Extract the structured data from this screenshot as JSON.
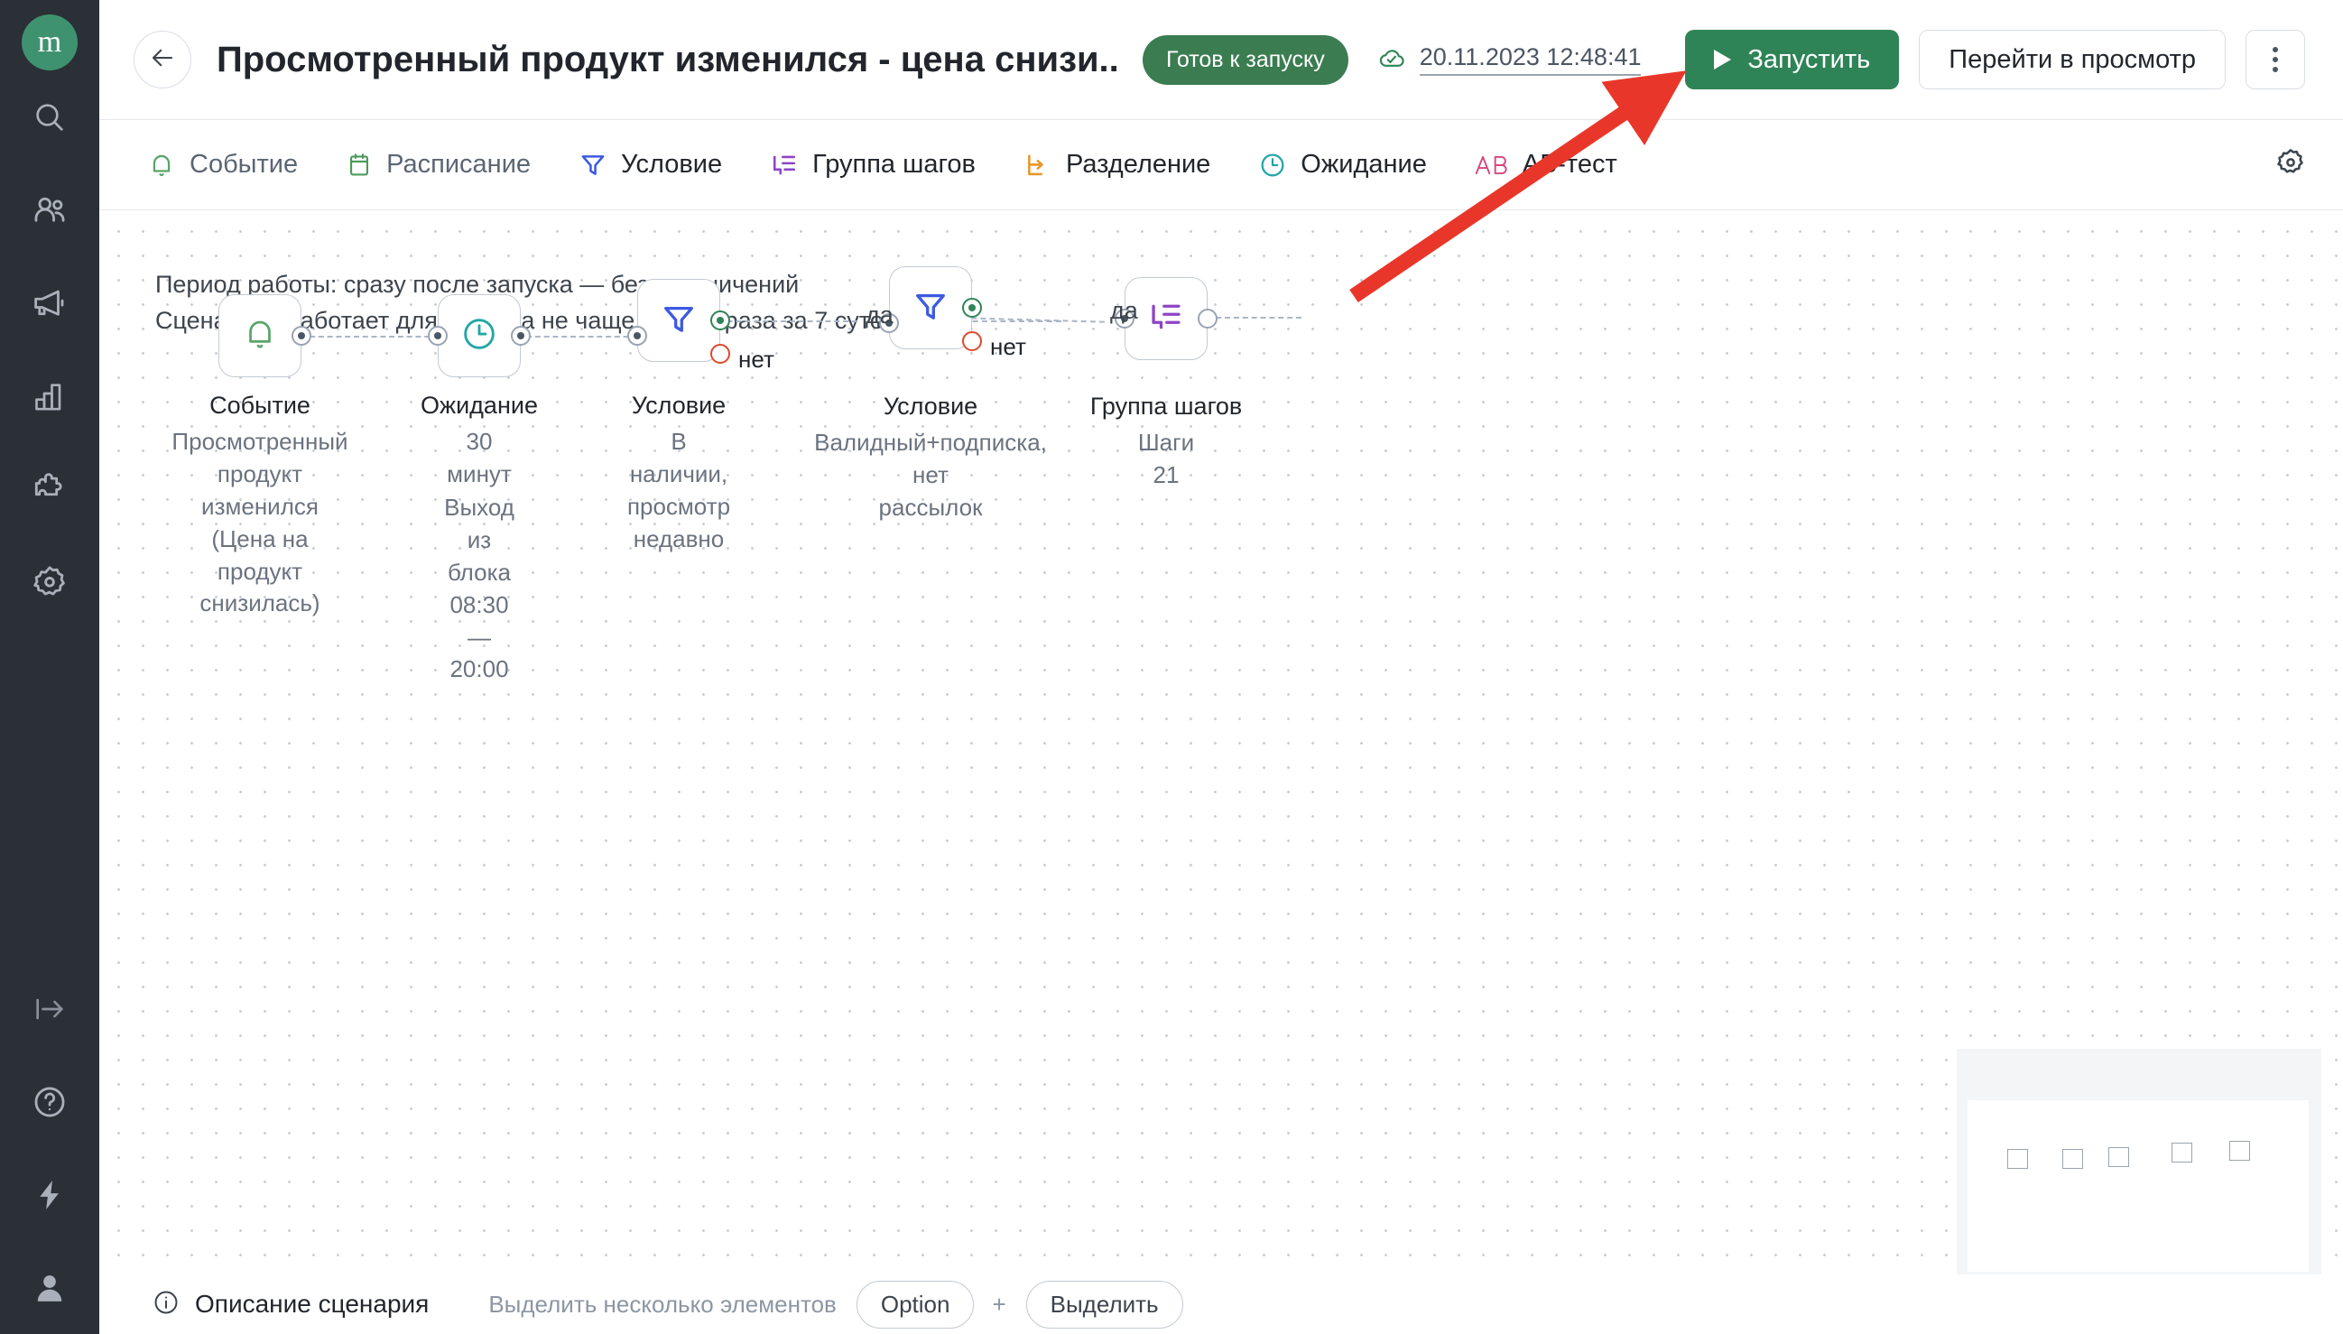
{
  "brand": {
    "logo_letter": "m",
    "accent": "#3f9270"
  },
  "sidebar": {
    "items": [
      {
        "name": "search-icon",
        "label": "Поиск"
      },
      {
        "name": "users-icon",
        "label": "Клиенты"
      },
      {
        "name": "megaphone-icon",
        "label": "Кампании"
      },
      {
        "name": "bar-chart-icon",
        "label": "Аналитика"
      },
      {
        "name": "puzzle-icon",
        "label": "Интеграции"
      },
      {
        "name": "gear-icon",
        "label": "Настройки"
      }
    ],
    "bottom_items": [
      {
        "name": "collapse-icon",
        "label": "Свернуть"
      },
      {
        "name": "help-icon",
        "label": "Помощь"
      },
      {
        "name": "lightning-icon",
        "label": "Активность"
      },
      {
        "name": "account-icon",
        "label": "Аккаунт"
      }
    ]
  },
  "header": {
    "back_label": "Назад",
    "title": "Просмотренный продукт изменился - цена снизи...",
    "status_badge": "Готов к запуску",
    "saved_timestamp": "20.11.2023 12:48:41",
    "saved_icon": "cloud-check-icon",
    "run_button": "Запустить",
    "preview_button": "Перейти в просмотр",
    "more_button": "Ещё",
    "run_button_color": "#2f8457",
    "status_badge_color": "#3b7d51"
  },
  "toolbar": {
    "items": [
      {
        "label": "Событие",
        "icon": "bell-icon",
        "color": "#5aa469",
        "emphasis": "muted"
      },
      {
        "label": "Расписание",
        "icon": "calendar-icon",
        "color": "#4c9a5a",
        "emphasis": "muted"
      },
      {
        "label": "Условие",
        "icon": "filter-icon",
        "color": "#3d5ae0",
        "emphasis": "dark"
      },
      {
        "label": "Группа шагов",
        "icon": "steps-icon",
        "color": "#8e44c4",
        "emphasis": "dark"
      },
      {
        "label": "Разделение",
        "icon": "split-icon",
        "color": "#e8972a",
        "emphasis": "dark"
      },
      {
        "label": "Ожидание",
        "icon": "clock-icon",
        "color": "#22a6a6",
        "emphasis": "dark"
      },
      {
        "label": "АБ-тест",
        "icon": "ab-icon",
        "color": "#d6467f",
        "emphasis": "dark"
      }
    ],
    "settings_label": "Настройки холста"
  },
  "canvas": {
    "period_line_1": "Период работы: сразу после запуска — без ограничений",
    "period_line_2": "Сценарий сработает для клиента не чаще одного раза за 7 суток",
    "nodes": [
      {
        "id": "event",
        "type_label": "Событие",
        "icon": "bell-icon",
        "icon_color": "#5aa469",
        "description": [
          "Просмотренный продукт",
          "изменился (Цена на продукт",
          "снизилась)"
        ]
      },
      {
        "id": "wait",
        "type_label": "Ожидание",
        "icon": "clock-icon",
        "icon_color": "#22a6a6",
        "description": [
          "30 минут"
        ],
        "extra": [
          "Выход из блока",
          "08:30 — 20:00"
        ]
      },
      {
        "id": "condition-1",
        "type_label": "Условие",
        "icon": "filter-icon",
        "icon_color": "#3d5ae0",
        "description": [
          "В наличии, просмотр недавно"
        ],
        "yes_label": "да",
        "no_label": "нет"
      },
      {
        "id": "condition-2",
        "type_label": "Условие",
        "icon": "filter-icon",
        "icon_color": "#3d5ae0",
        "description": [
          "Валидный+подписка, нет",
          "рассылок"
        ],
        "yes_label": "да",
        "no_label": "нет"
      },
      {
        "id": "step-group",
        "type_label": "Группа шагов",
        "icon": "steps-icon",
        "icon_color": "#8e44c4",
        "description": [
          "Шаги 21"
        ]
      }
    ]
  },
  "bottombar": {
    "description_label": "Описание сценария",
    "hint_text": "Выделить несколько элементов",
    "key_option": "Option",
    "plus": "+",
    "key_select": "Выделить"
  },
  "annotation": {
    "arrow_color": "#e8372a",
    "points_to": "Запустить"
  }
}
